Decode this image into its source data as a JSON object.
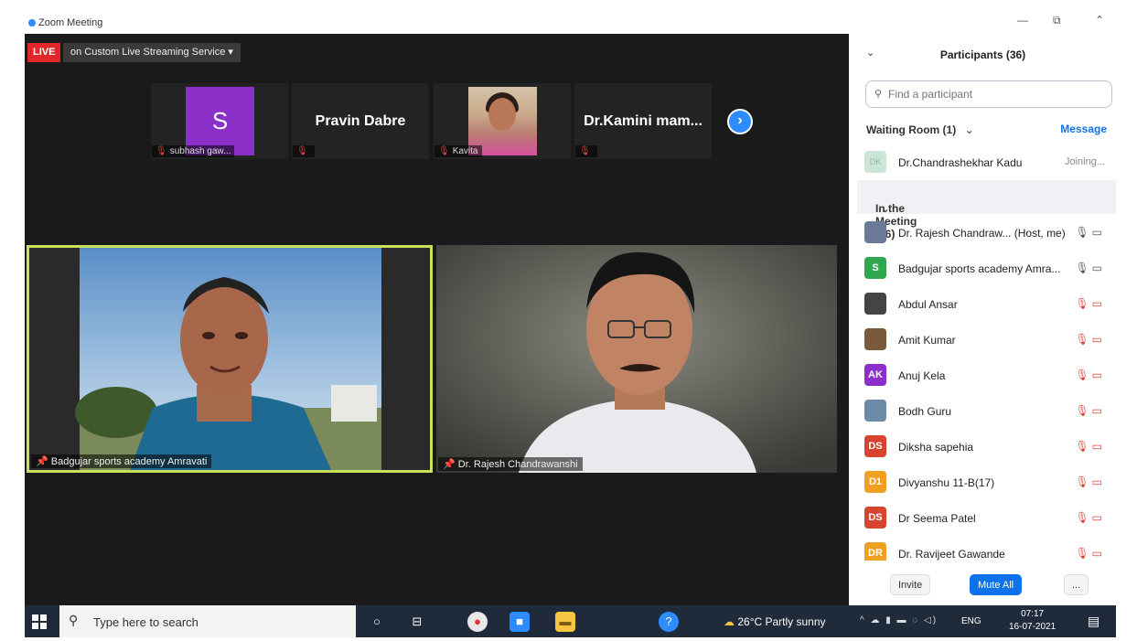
{
  "window": {
    "title": "Zoom Meeting",
    "controls": [
      "—",
      "⧉",
      "⌃"
    ]
  },
  "live": {
    "badge": "LIVE",
    "stream": "on Custom Live Streaming Service ▾"
  },
  "gallery": [
    {
      "type": "avatar",
      "avatar_letter": "S",
      "avatar_color": "#8b2fc9",
      "label": "subhash gaw..."
    },
    {
      "type": "name",
      "display_name": "Pravin Dabre",
      "label": ""
    },
    {
      "type": "photo",
      "label": "Kavita"
    },
    {
      "type": "name",
      "display_name": "Dr.Kamini  mam...",
      "label": ""
    }
  ],
  "gallery_next_icon": "chevron-right-icon",
  "videos": {
    "left": {
      "name": "Badgujar sports academy Amravati",
      "highlight_color": "#c8e05a"
    },
    "right": {
      "name": "Dr. Rajesh Chandrawanshi"
    }
  },
  "participants_panel": {
    "title": "Participants (36)",
    "search_placeholder": "Find a participant",
    "waiting_room": {
      "header": "Waiting Room (1)",
      "message_label": "Message",
      "person": {
        "initials": "DK",
        "name": "Dr.Chandrashekhar Kadu",
        "status": "Joining..."
      }
    },
    "in_meeting_header": "In the Meeting (36)",
    "list": [
      {
        "initials": "",
        "avatar_color": "#6b7a99",
        "name": "Dr. Rajesh Chandraw...  (Host, me)",
        "mic": "on",
        "video": "on"
      },
      {
        "initials": "S",
        "avatar_color": "#2fa84f",
        "name": "Badgujar sports academy Amra...",
        "mic": "on",
        "video": "on"
      },
      {
        "initials": "",
        "avatar_color": "#444444",
        "name": "Abdul Ansar",
        "mic": "off",
        "video": "off"
      },
      {
        "initials": "",
        "avatar_color": "#7a5a3a",
        "name": "Amit Kumar",
        "mic": "off",
        "video": "off"
      },
      {
        "initials": "AK",
        "avatar_color": "#8b2fc9",
        "name": "Anuj Kela",
        "mic": "off",
        "video": "off"
      },
      {
        "initials": "",
        "avatar_color": "#6a8aa8",
        "name": "Bodh Guru",
        "mic": "off",
        "video": "off"
      },
      {
        "initials": "DS",
        "avatar_color": "#d9442e",
        "name": "Diksha sapehia",
        "mic": "off",
        "video": "off"
      },
      {
        "initials": "D1",
        "avatar_color": "#f0a020",
        "name": "Divyanshu 11-B(17)",
        "mic": "off",
        "video": "off"
      },
      {
        "initials": "DS",
        "avatar_color": "#d9442e",
        "name": "Dr Seema Patel",
        "mic": "off",
        "video": "off"
      },
      {
        "initials": "DR",
        "avatar_color": "#f0a020",
        "name": "Dr. Ravijeet Gawande",
        "mic": "off",
        "video": "off"
      }
    ],
    "footer": {
      "invite": "Invite",
      "mute_all": "Mute All",
      "more": "..."
    }
  },
  "taskbar": {
    "search_placeholder": "Type here to search",
    "weather": "26°C  Partly sunny",
    "language": "ENG",
    "time": "07:17",
    "date": "16-07-2021"
  }
}
